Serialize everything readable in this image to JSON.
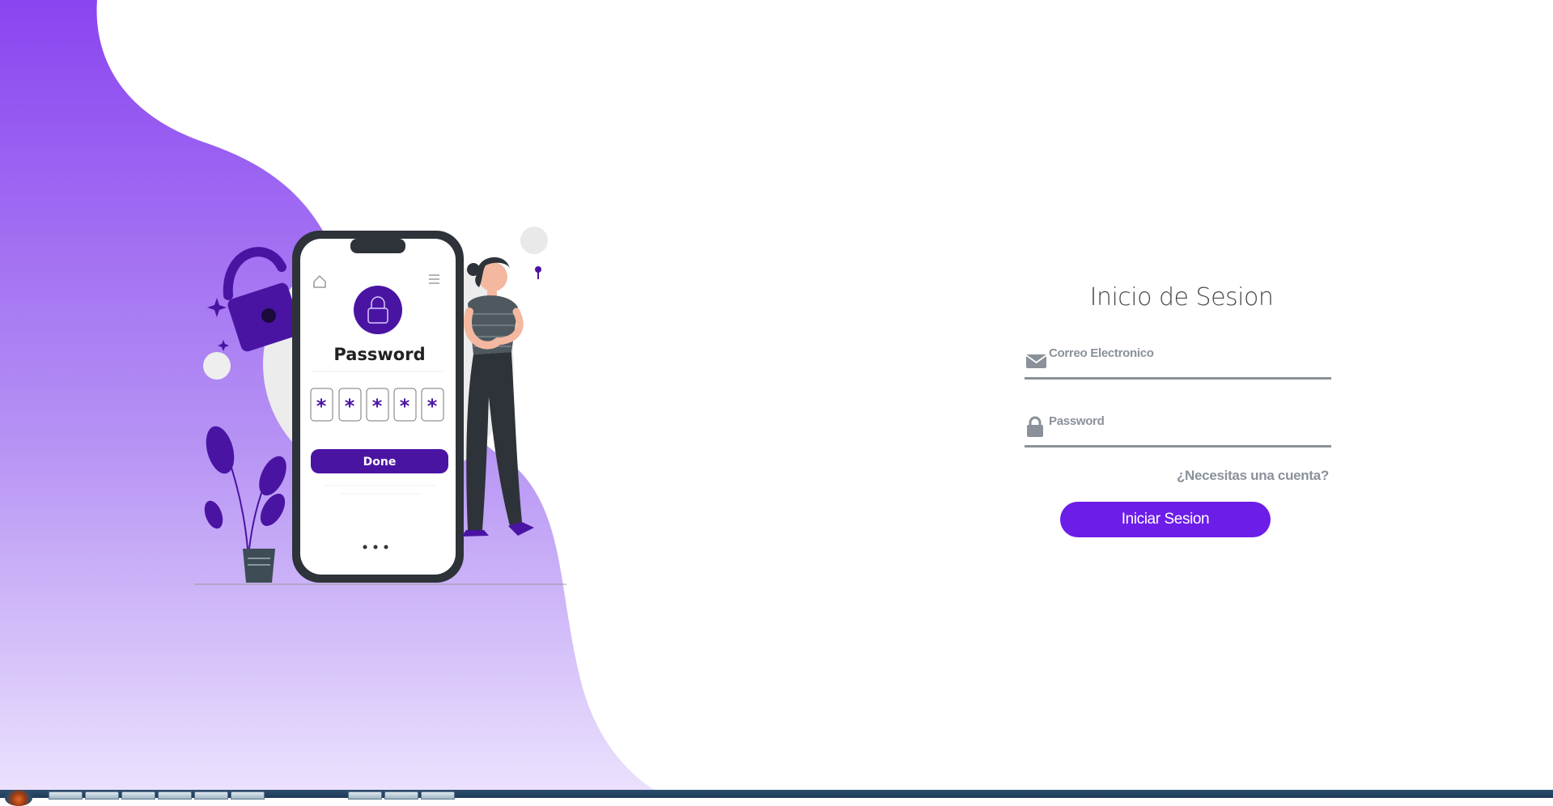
{
  "colors": {
    "accent": "#6d1de8",
    "illustration_purple": "#4a14a3",
    "muted_text": "#8a919a",
    "wave_top": "#8a45f0",
    "wave_bottom": "#ebe2fd"
  },
  "illustration": {
    "phone_title": "Password",
    "pin_symbols": [
      "*",
      "*",
      "*",
      "*",
      "*"
    ],
    "done_label": "Done"
  },
  "login": {
    "title": "Inicio de Sesion",
    "email_placeholder": "Correo Electronico",
    "email_icon": "envelope-icon",
    "password_placeholder": "Password",
    "password_icon": "padlock-icon",
    "need_account_link": "¿Necesitas una cuenta?",
    "submit_label": "Iniciar Sesion"
  },
  "taskbar": {
    "start_icon": "windows-start-orb-icon"
  }
}
